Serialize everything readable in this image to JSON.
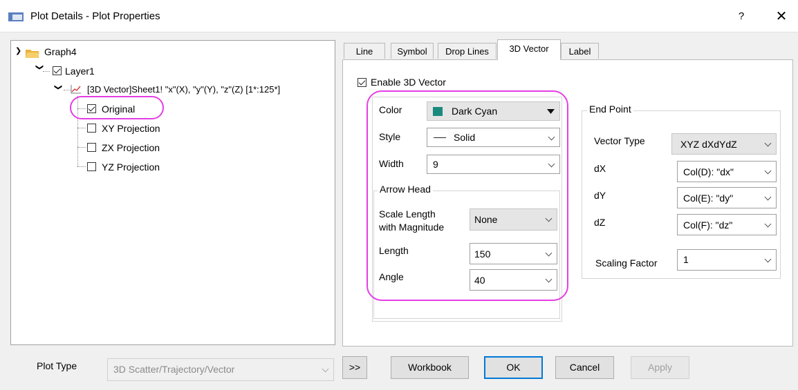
{
  "window": {
    "title": "Plot Details - Plot Properties",
    "help": "?",
    "close": "✕"
  },
  "tree": {
    "graph": "Graph4",
    "layer": "Layer1",
    "plot": "[3D Vector]Sheet1! \"x\"(X), \"y\"(Y), \"z\"(Z) [1*:125*]",
    "items": [
      {
        "label": "Original",
        "checked": true
      },
      {
        "label": "XY Projection",
        "checked": false
      },
      {
        "label": "ZX Projection",
        "checked": false
      },
      {
        "label": "YZ Projection",
        "checked": false
      }
    ]
  },
  "tabs": [
    "Line",
    "Symbol",
    "Drop Lines",
    "3D Vector",
    "Label"
  ],
  "active_tab": "3D Vector",
  "enable": {
    "label": "Enable 3D Vector",
    "checked": true
  },
  "vector": {
    "color_label": "Color",
    "color_value": "Dark Cyan",
    "color_swatch": "#1b8a7e",
    "style_label": "Style",
    "style_value": "Solid",
    "width_label": "Width",
    "width_value": "9"
  },
  "arrow_head": {
    "title": "Arrow Head",
    "scale_label_1": "Scale Length",
    "scale_label_2": "with Magnitude",
    "scale_value": "None",
    "length_label": "Length",
    "length_value": "150",
    "angle_label": "Angle",
    "angle_value": "40"
  },
  "end_point": {
    "title": "End Point",
    "vector_type_label": "Vector Type",
    "vector_type_value": "XYZ dXdYdZ",
    "dx_label": "dX",
    "dx_value": "Col(D): \"dx\"",
    "dy_label": "dY",
    "dy_value": "Col(E): \"dy\"",
    "dz_label": "dZ",
    "dz_value": "Col(F): \"dz\"",
    "scaling_label": "Scaling Factor",
    "scaling_value": "1"
  },
  "footer": {
    "plot_type_label": "Plot Type",
    "plot_type_value": "3D Scatter/Trajectory/Vector",
    "expand": ">>",
    "workbook": "Workbook",
    "ok": "OK",
    "cancel": "Cancel",
    "apply": "Apply"
  },
  "colors": {
    "highlight": "#e53de5",
    "focus": "#0078d7"
  }
}
